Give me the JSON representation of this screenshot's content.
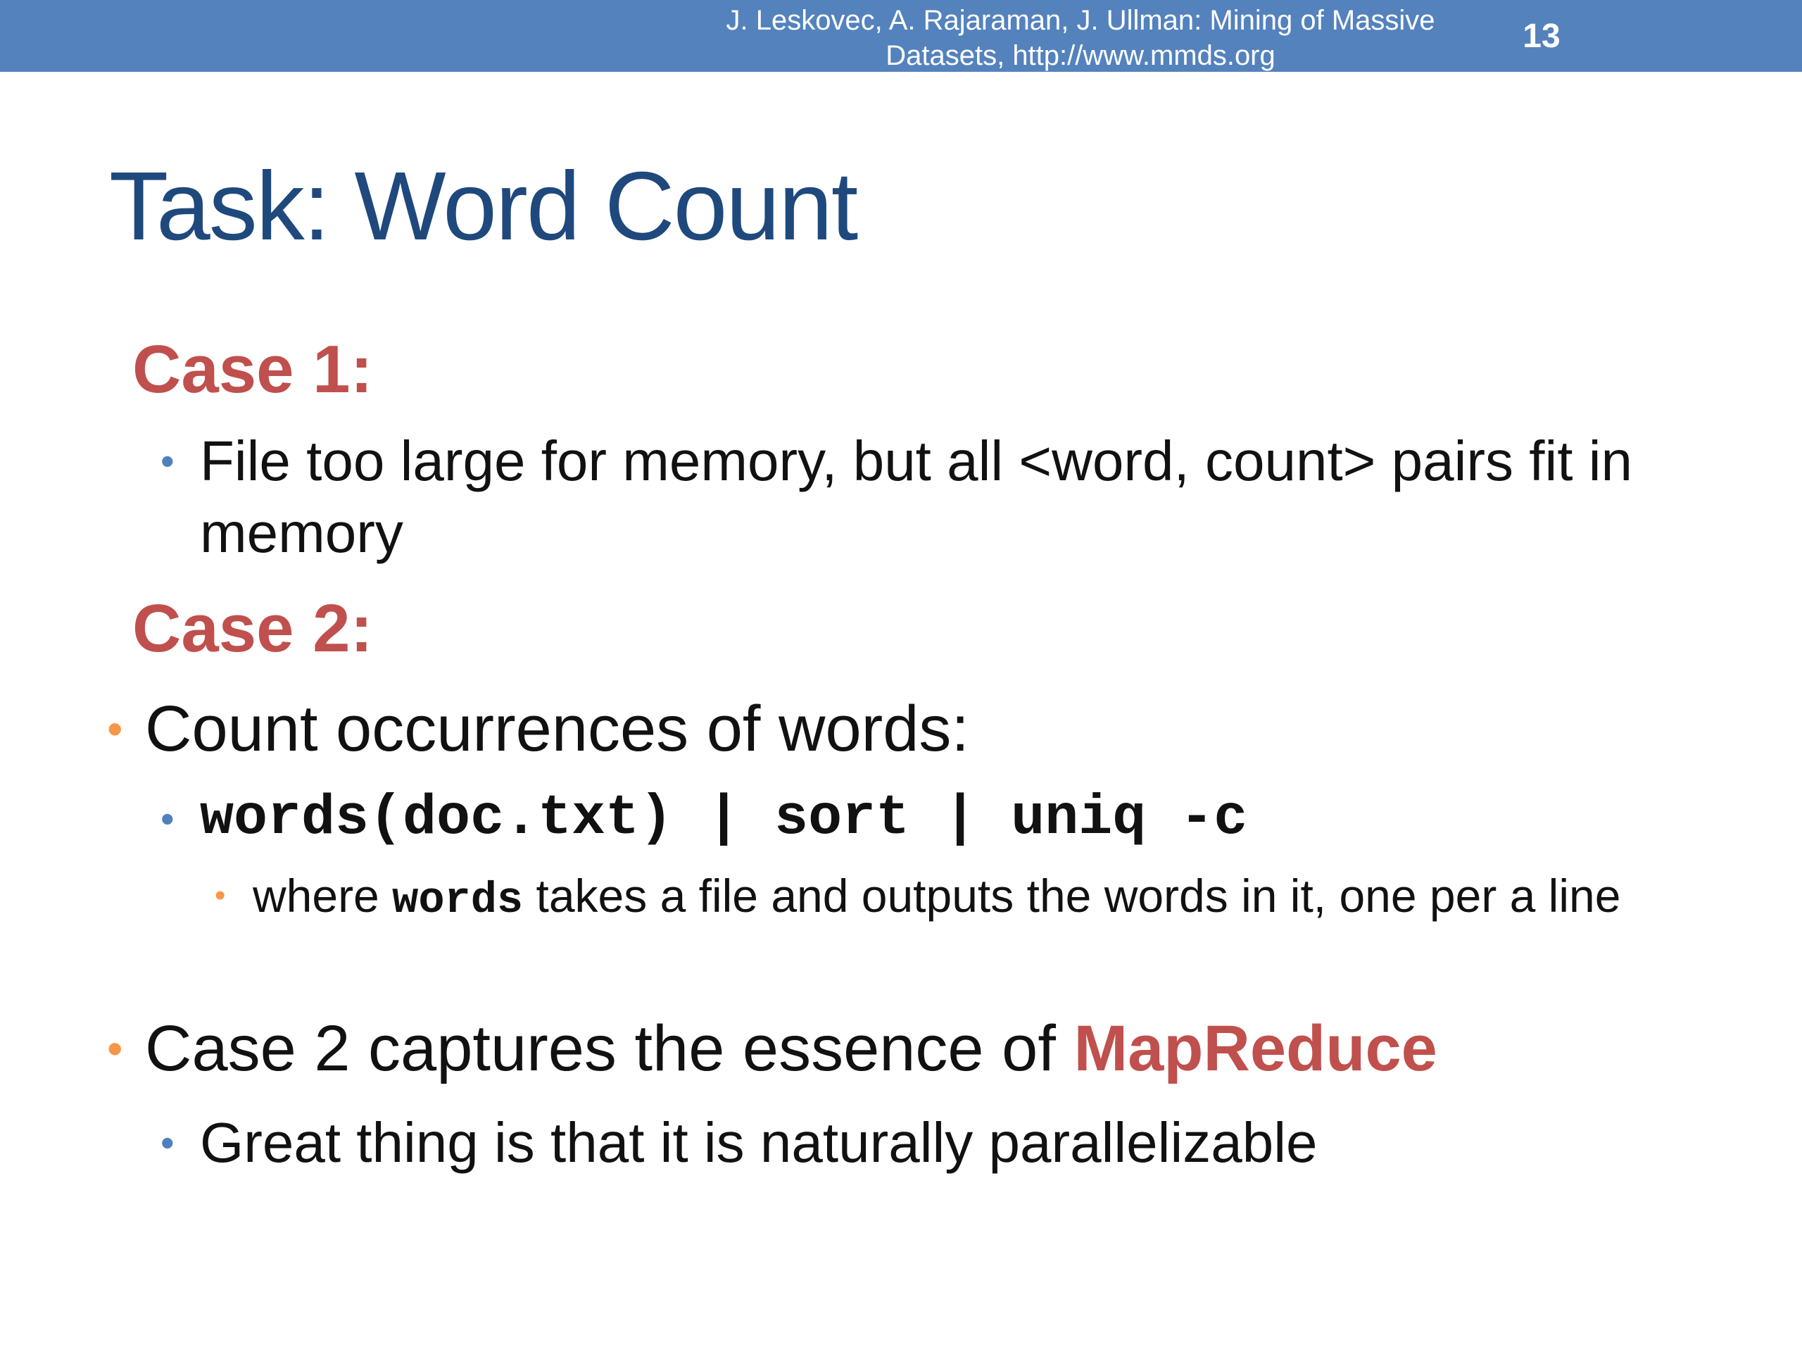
{
  "header": {
    "citation_line1": "J. Leskovec, A. Rajaraman, J. Ullman: Mining of Massive",
    "citation_line2": "Datasets, http://www.mmds.org",
    "page_number": "13"
  },
  "title": "Task: Word Count",
  "case1": {
    "heading": "Case 1:",
    "bullet": "File too large for memory, but all <word, count> pairs fit in memory"
  },
  "case2": {
    "heading": "Case 2:"
  },
  "bullets": {
    "count_occurrences": "Count occurrences of words:",
    "command": "words(doc.txt) | sort | uniq -c",
    "where_prefix": "where ",
    "where_code": "words",
    "where_suffix": " takes a file and outputs the words in it, one per a line",
    "essence_prefix": "Case 2 captures the essence of ",
    "essence_highlight": "MapReduce",
    "great_thing": "Great thing is that it is naturally parallelizable"
  },
  "colors": {
    "header_bar": "#5482bd",
    "title": "#1f497d",
    "case_heading": "#c0504d",
    "highlight": "#c0504d",
    "bullet_blue": "#4f81bd",
    "bullet_orange": "#f79646"
  }
}
